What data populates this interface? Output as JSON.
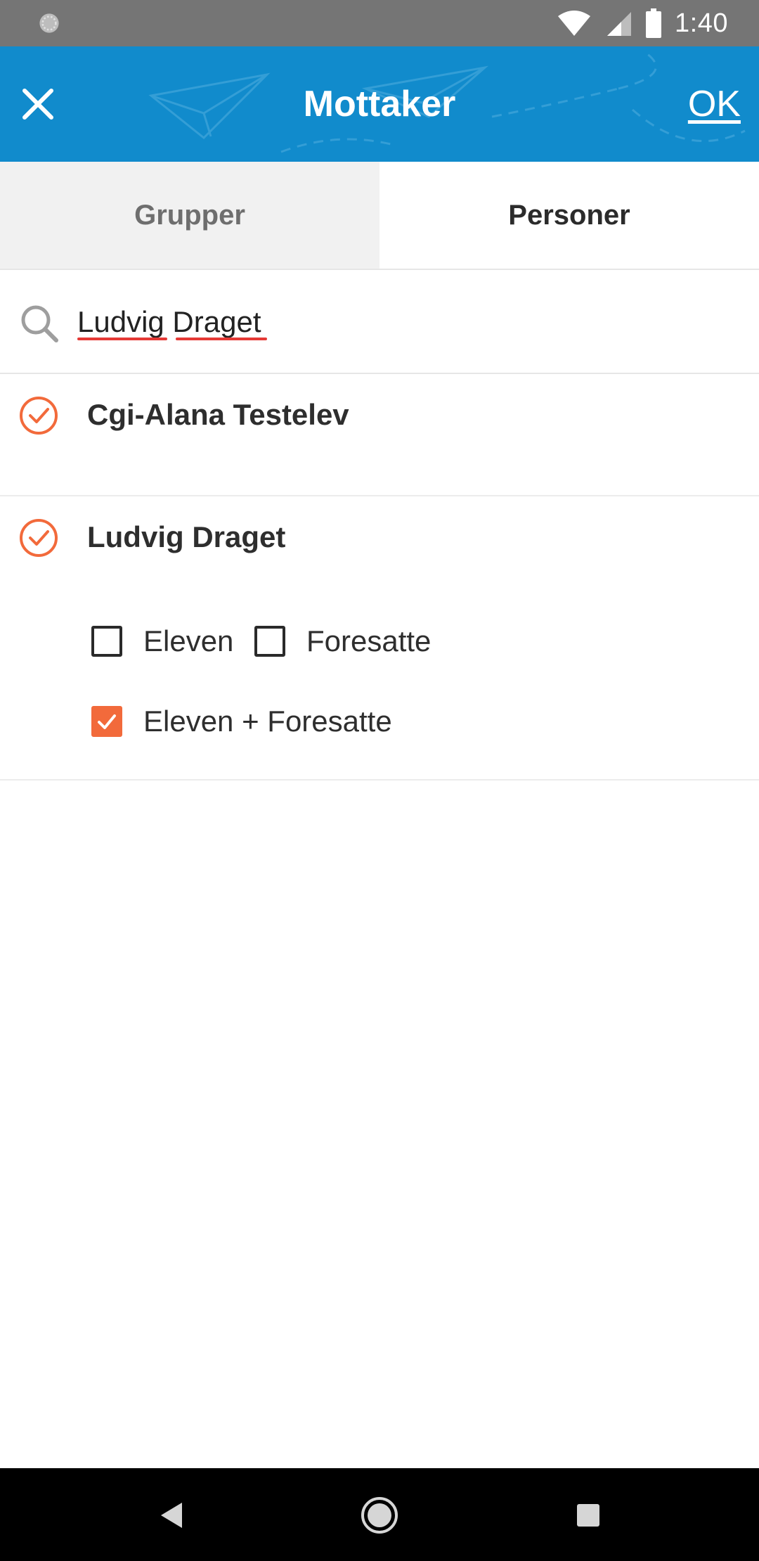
{
  "status_bar": {
    "time": "1:40",
    "icons": [
      "sync-icon",
      "wifi-icon",
      "cell-signal-icon",
      "battery-icon"
    ]
  },
  "app_bar": {
    "title": "Mottaker",
    "ok_label": "OK",
    "close_icon": "close-icon",
    "background_color": "#118bcc"
  },
  "tabs": [
    {
      "label": "Grupper",
      "active": false
    },
    {
      "label": "Personer",
      "active": true
    }
  ],
  "search": {
    "value": "Ludvig Draget",
    "placeholder": ""
  },
  "results": [
    {
      "name": "Cgi-Alana Testelev",
      "selected": true
    },
    {
      "name": "Ludvig Draget",
      "selected": true,
      "options": [
        {
          "label": "Eleven",
          "checked": false
        },
        {
          "label": "Foresatte",
          "checked": false
        },
        {
          "label": "Eleven + Foresatte",
          "checked": true
        }
      ]
    }
  ],
  "colors": {
    "accent": "#f26a3b",
    "header": "#118bcc",
    "status_bar": "#757575"
  },
  "nav_bar": {
    "buttons": [
      "back-icon",
      "home-icon",
      "recents-icon"
    ]
  }
}
